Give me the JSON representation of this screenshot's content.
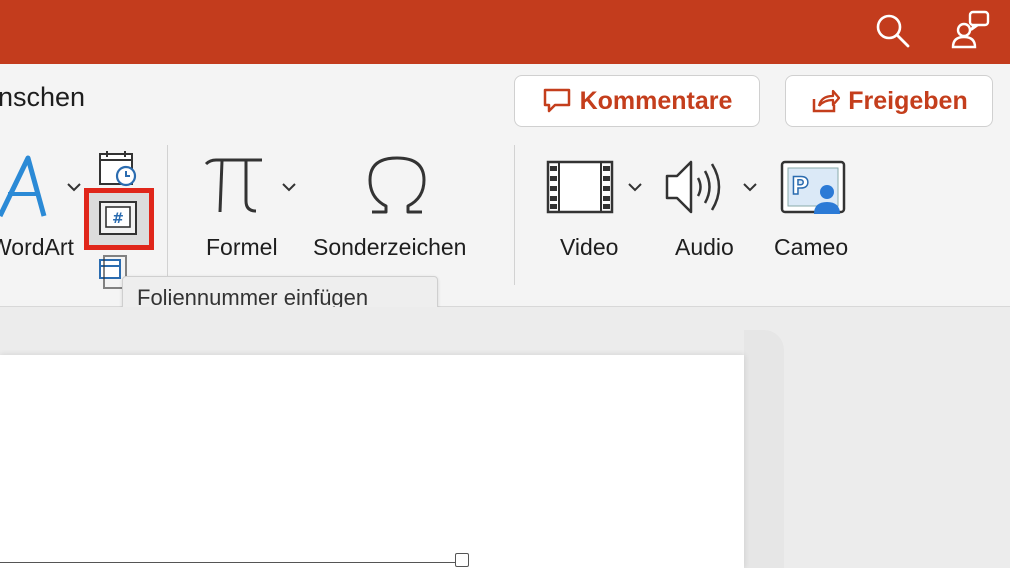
{
  "titlebar": {
    "search_icon": "search-icon",
    "share_people_icon": "share-people-icon",
    "color": "#c33c1d"
  },
  "ribbon": {
    "tab_partial_label": "nschen",
    "comments_label": "Kommentare",
    "share_label": "Freigeben",
    "accent_color": "#c43e1c",
    "wordart_label": "WordArt",
    "formula_label": "Formel",
    "symbol_label": "Sonderzeichen",
    "video_label": "Video",
    "audio_label": "Audio",
    "cameo_label": "Cameo"
  },
  "tooltip": {
    "text": "Foliennummer einfügen"
  },
  "highlight_color": "#e0261a"
}
